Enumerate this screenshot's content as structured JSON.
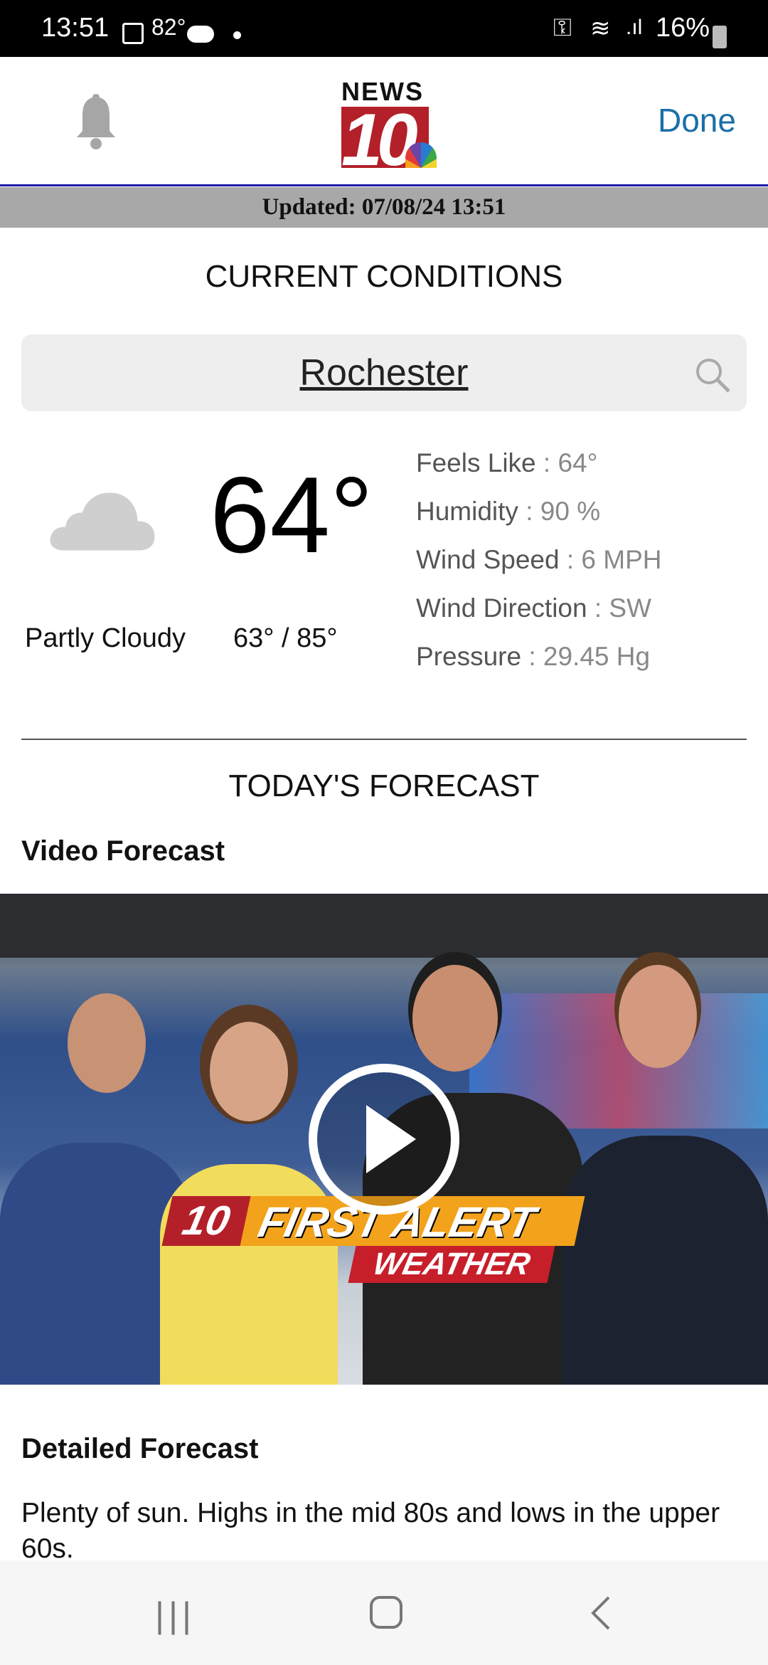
{
  "status_bar": {
    "time": "13:51",
    "temp": "82°",
    "battery": "16%"
  },
  "header": {
    "logo_text": "NEWS",
    "logo_number": "10",
    "done_label": "Done"
  },
  "updated": "Updated: 07/08/24 13:51",
  "current": {
    "heading": "CURRENT CONDITIONS",
    "location": "Rochester",
    "temperature": "64°",
    "condition": "Partly Cloudy",
    "low_high": "63° / 85°",
    "details": [
      {
        "label": "Feels Like",
        "value": "64°"
      },
      {
        "label": "Humidity",
        "value": "90 %"
      },
      {
        "label": "Wind Speed",
        "value": "6 MPH"
      },
      {
        "label": "Wind Direction",
        "value": "SW"
      },
      {
        "label": "Pressure",
        "value": "29.45 Hg"
      }
    ]
  },
  "forecast": {
    "heading": "TODAY'S FORECAST",
    "video_title": "Video Forecast",
    "video_logo": {
      "line1": "FIRST ALERT",
      "line2": "WEATHER",
      "badge": "10"
    },
    "detailed_title": "Detailed Forecast",
    "detailed_text": "Plenty of sun. Highs in the mid 80s and lows in the upper 60s."
  },
  "colors": {
    "accent": "#1a6fa8",
    "logo_red": "#b3202a"
  }
}
